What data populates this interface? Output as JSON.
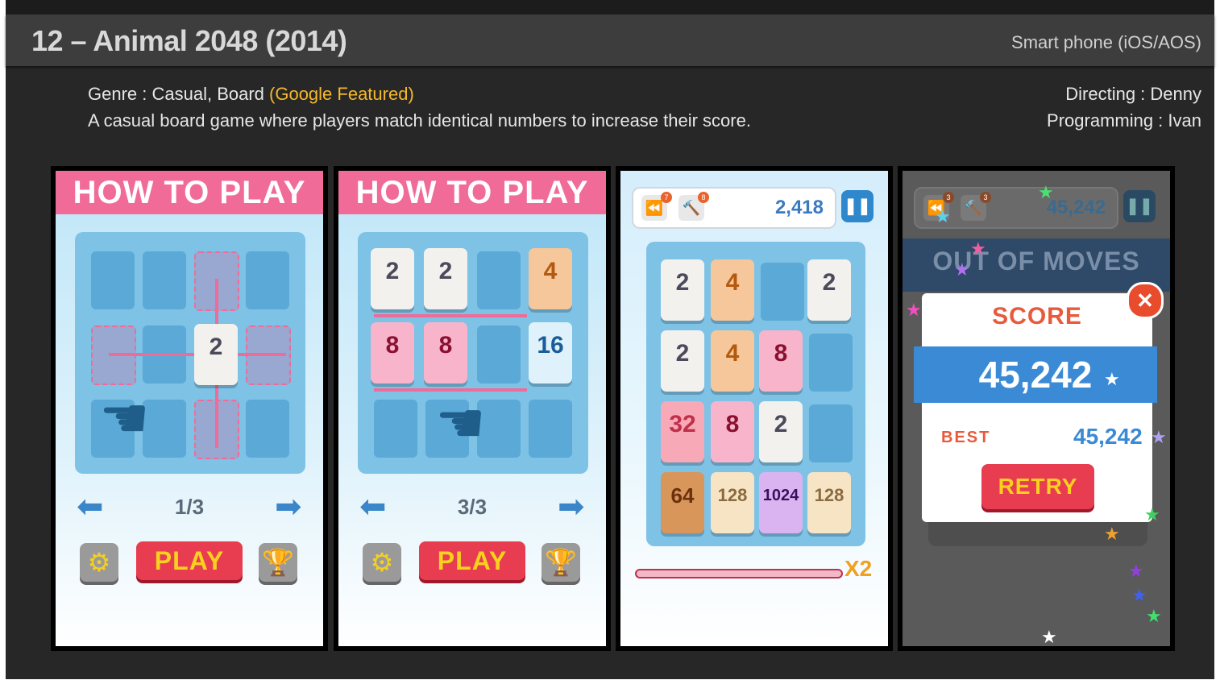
{
  "header": {
    "title": "12 – Animal 2048 (2014)",
    "platform": "Smart phone (iOS/AOS)"
  },
  "info": {
    "genre_prefix": "Genre : Casual, Board ",
    "genre_highlight": "(Google Featured)",
    "description": "A casual board game where players match identical numbers to increase their score.",
    "directing": "Directing : Denny",
    "programming": "Programming : Ivan"
  },
  "colors": {
    "highlight": "#f5b82a",
    "pink_header": "#f06b97",
    "blue": "#3b8ad6"
  },
  "screens": {
    "tutorial1": {
      "header": "HOW TO PLAY",
      "tile": "2",
      "pager": "1/3",
      "play": "PLAY",
      "icons": [
        "arrow-left-icon",
        "arrow-right-icon",
        "gear-icon",
        "trophy-icon",
        "hand-icon"
      ]
    },
    "tutorial3": {
      "header": "HOW TO PLAY",
      "tiles": [
        "2",
        "2",
        "4",
        "8",
        "8",
        "16"
      ],
      "pager": "3/3",
      "play": "PLAY"
    },
    "game": {
      "rewind_count": "7",
      "wand_count": "8",
      "score": "2,418",
      "grid": [
        [
          "2",
          "4",
          "",
          "2"
        ],
        [
          "2",
          "4",
          "8",
          ""
        ],
        [
          "32",
          "8",
          "2",
          ""
        ],
        [
          "64",
          "128",
          "1024",
          "128"
        ]
      ],
      "multiplier": "X2"
    },
    "over": {
      "rewind_count": "3",
      "wand_count": "3",
      "score_top": "45,242",
      "banner": "OUT OF MOVES",
      "score_label": "SCORE",
      "score": "45,242",
      "best_label": "BEST",
      "best": "45,242",
      "retry": "RETRY"
    }
  }
}
